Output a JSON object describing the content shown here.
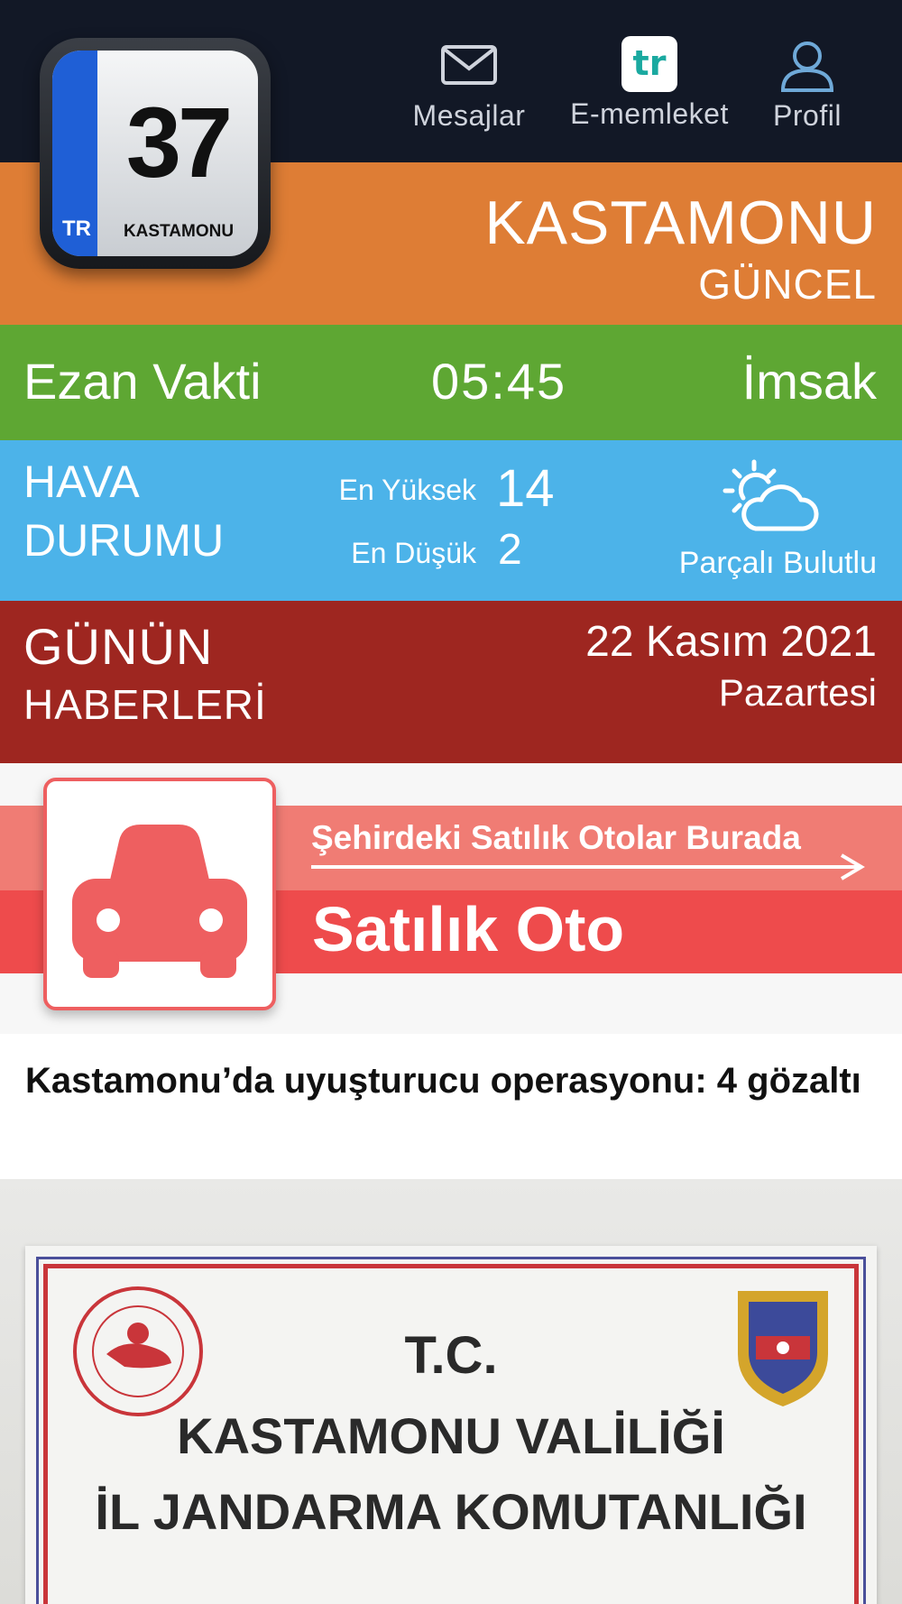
{
  "nav": {
    "messages_label": "Mesajlar",
    "ememleket_label": "E-memleket",
    "ememleket_badge": "tr",
    "profile_label": "Profil"
  },
  "logo": {
    "number": "37",
    "country": "TR",
    "city": "KASTAMONU"
  },
  "header": {
    "city": "KASTAMONU",
    "subtitle": "GÜNCEL"
  },
  "prayer": {
    "label": "Ezan Vakti",
    "time": "05:45",
    "name": "İmsak"
  },
  "weather": {
    "title_line1": "HAVA",
    "title_line2": "DURUMU",
    "high_label": "En Yüksek",
    "high_value": "14",
    "low_label": "En Düşük",
    "low_value": "2",
    "condition": "Parçalı Bulutlu",
    "icon": "partly-cloudy-icon"
  },
  "news_header": {
    "title_line1": "GÜNÜN",
    "title_line2": "HABERLERİ",
    "date": "22 Kasım 2021",
    "day": "Pazartesi"
  },
  "ad": {
    "subtitle": "Şehirdeki Satılık Otolar Burada",
    "title": "Satılık Oto",
    "icon": "car-icon"
  },
  "article": {
    "title": "Kastamonu’da uyuşturucu operasyonu: 4 gözaltı",
    "image_text": {
      "line1": "T.C.",
      "line2": "KASTAMONU VALİLİĞİ",
      "line3": "İL JANDARMA KOMUTANLIĞI"
    }
  },
  "colors": {
    "topbar": "#121826",
    "orange": "#de7d35",
    "green": "#5ea733",
    "blue": "#4cb3e9",
    "red": "#9e2620",
    "ad_red": "#ee4b4c"
  }
}
